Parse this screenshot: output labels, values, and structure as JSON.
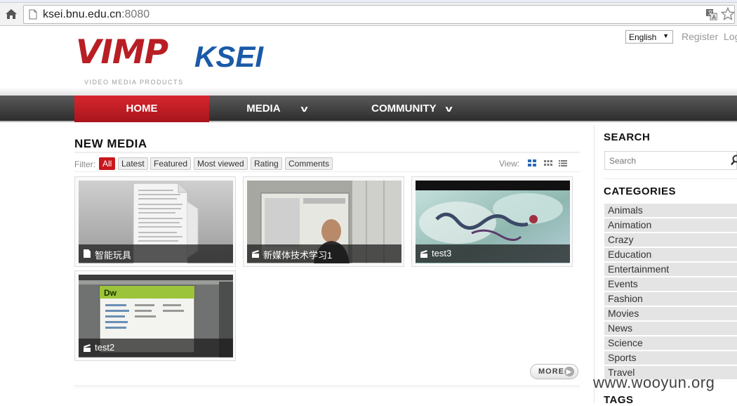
{
  "browser": {
    "url_host": "ksei.bnu.edu.cn",
    "url_port": ":8080"
  },
  "header": {
    "language": "English",
    "register": "Register",
    "login": "Log",
    "logo": {
      "brand": "VIMP",
      "tagline": "VIDEO MEDIA PRODUCTS",
      "site": "KSEI"
    }
  },
  "nav": {
    "home": "HOME",
    "media": "MEDIA",
    "community": "COMMUNITY"
  },
  "main": {
    "title": "NEW MEDIA",
    "filter_label": "Filter:",
    "filters": [
      "All",
      "Latest",
      "Featured",
      "Most viewed",
      "Rating",
      "Comments"
    ],
    "active_filter": "All",
    "view_label": "View:",
    "media": [
      {
        "title": "智能玩具",
        "type": "document"
      },
      {
        "title": "新媒体技术学习1",
        "type": "video"
      },
      {
        "title": "test3",
        "type": "video"
      },
      {
        "title": "test2",
        "type": "video"
      }
    ],
    "more": "MORE"
  },
  "sidebar": {
    "search_title": "SEARCH",
    "search_placeholder": "Search",
    "categories_title": "CATEGORIES",
    "categories": [
      "Animals",
      "Animation",
      "Crazy",
      "Education",
      "Entertainment",
      "Events",
      "Fashion",
      "Movies",
      "News",
      "Science",
      "Sports",
      "Travel"
    ],
    "tags_title": "TAGS"
  },
  "watermark": "www.wooyun.org",
  "colors": {
    "brand_red": "#c8161d",
    "brand_blue": "#1a5aa8",
    "nav_dark": "#3a3a3a"
  }
}
